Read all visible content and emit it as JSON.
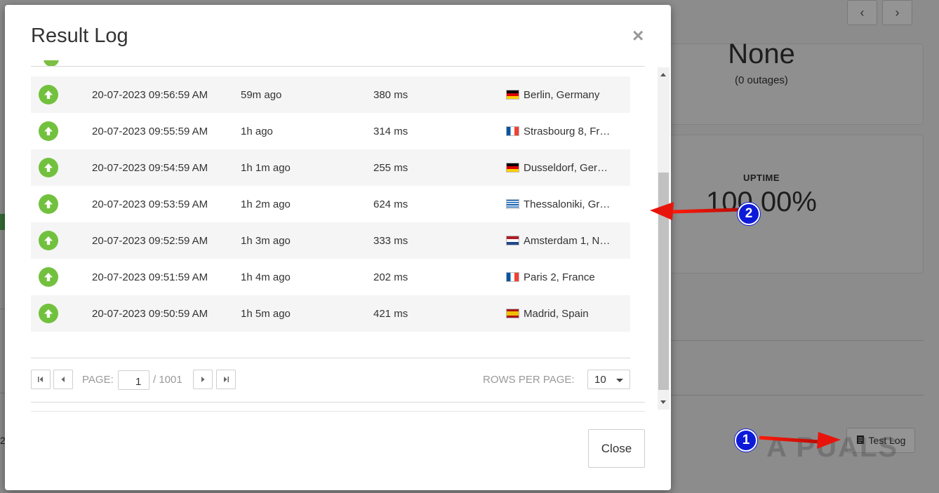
{
  "background": {
    "summary_value": "None",
    "summary_sub": "(0 outages)",
    "uptime_label": "UPTIME",
    "uptime_value": "100.00%",
    "test_log_label": "Test Log",
    "side_number": "2",
    "watermark": "A PUALS"
  },
  "modal": {
    "title": "Result Log",
    "close_icon": "×",
    "close_button": "Close",
    "rows": [
      {
        "status": "up-arrow-icon",
        "date": "20-07-2023 09:56:59 AM",
        "ago": "59m ago",
        "ms": "380 ms",
        "flag": "de",
        "location": "Berlin, Germany"
      },
      {
        "status": "up-arrow-icon",
        "date": "20-07-2023 09:55:59 AM",
        "ago": "1h ago",
        "ms": "314 ms",
        "flag": "fr",
        "location": "Strasbourg 8, Fr…"
      },
      {
        "status": "up-arrow-icon",
        "date": "20-07-2023 09:54:59 AM",
        "ago": "1h 1m ago",
        "ms": "255 ms",
        "flag": "de",
        "location": "Dusseldorf, Ger…"
      },
      {
        "status": "up-arrow-icon",
        "date": "20-07-2023 09:53:59 AM",
        "ago": "1h 2m ago",
        "ms": "624 ms",
        "flag": "gr",
        "location": "Thessaloniki, Gr…"
      },
      {
        "status": "up-arrow-icon",
        "date": "20-07-2023 09:52:59 AM",
        "ago": "1h 3m ago",
        "ms": "333 ms",
        "flag": "nl",
        "location": "Amsterdam 1, N…"
      },
      {
        "status": "up-arrow-icon",
        "date": "20-07-2023 09:51:59 AM",
        "ago": "1h 4m ago",
        "ms": "202 ms",
        "flag": "fr",
        "location": "Paris 2, France"
      },
      {
        "status": "up-arrow-icon",
        "date": "20-07-2023 09:50:59 AM",
        "ago": "1h 5m ago",
        "ms": "421 ms",
        "flag": "es",
        "location": "Madrid, Spain"
      }
    ],
    "pager": {
      "page_label": "PAGE:",
      "page_value": "1",
      "page_total": "/ 1001",
      "rows_label": "ROWS PER PAGE:",
      "rows_value": "10"
    }
  },
  "annotations": {
    "badge_1": "1",
    "badge_2": "2",
    "arrow_color": "#e8140c"
  },
  "colors": {
    "status_green": "#72c13e",
    "badge_blue": "#0d1bd8"
  }
}
